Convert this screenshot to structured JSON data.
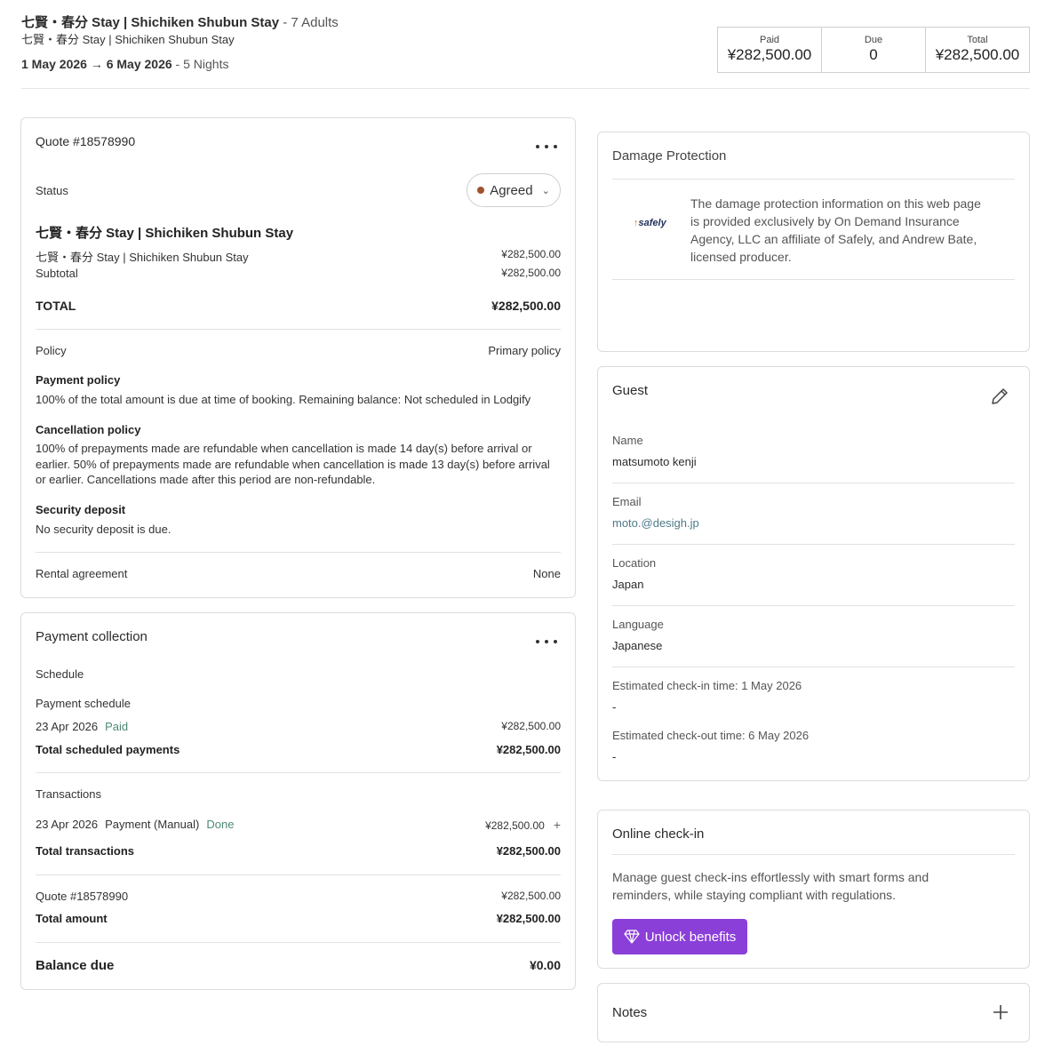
{
  "header": {
    "title_main": "七賢・春分",
    "title_main_suffix": " Stay | Shichiken Shubun Stay",
    "title_guests": " - 7 Adults",
    "subtitle": "七賢・春分 Stay | Shichiken Shubun Stay",
    "dates": "1 May 2026 → 6 May 2026",
    "nights": " - 5 Nights"
  },
  "totals": {
    "paid_label": "Paid",
    "paid_value": "¥282,500.00",
    "due_label": "Due",
    "due_value": "0",
    "total_label": "Total",
    "total_value": "¥282,500.00"
  },
  "quote": {
    "title": "Quote #18578990",
    "status_label": "Status",
    "status_value": "Agreed",
    "property_name": "七賢・春分 Stay | Shichiken Shubun Stay",
    "line_item": "七賢・春分 Stay | Shichiken Shubun Stay",
    "line_amount": "¥282,500.00",
    "subtotal_label": "Subtotal",
    "subtotal_value": "¥282,500.00",
    "total_label": "TOTAL",
    "total_value": "¥282,500.00",
    "policy_label": "Policy",
    "policy_value": "Primary policy",
    "payment_policy_title": "Payment policy",
    "payment_policy_text": "100% of the total amount is due at time of booking. Remaining balance: Not scheduled in Lodgify",
    "cancellation_title": "Cancellation policy",
    "cancellation_text": "100% of prepayments made are refundable when cancellation is made 14 day(s) before arrival or earlier. 50% of prepayments made are refundable when cancellation is made 13 day(s) before arrival or earlier. Cancellations made after this period are non-refundable.",
    "security_title": "Security deposit",
    "security_text": "No security deposit is due.",
    "rental_label": "Rental agreement",
    "rental_value": "None"
  },
  "payment": {
    "title": "Payment collection",
    "schedule_label": "Schedule",
    "payment_schedule_label": "Payment schedule",
    "sched_date": "23 Apr 2026",
    "sched_status": "Paid",
    "sched_amount": "¥282,500.00",
    "total_sched_label": "Total scheduled payments",
    "total_sched_value": "¥282,500.00",
    "transactions_label": "Transactions",
    "tx_date": "23 Apr 2026",
    "tx_type": "Payment (Manual)",
    "tx_status": "Done",
    "tx_amount": "¥282,500.00",
    "total_tx_label": "Total transactions",
    "total_tx_value": "¥282,500.00",
    "quote_ref": "Quote #18578990",
    "quote_ref_value": "¥282,500.00",
    "total_amount_label": "Total amount",
    "total_amount_value": "¥282,500.00",
    "balance_label": "Balance due",
    "balance_value": "¥0.00"
  },
  "damage": {
    "title": "Damage Protection",
    "logo_text": "safely",
    "text": "The damage protection information on this web page is provided exclusively by On Demand Insurance Agency, LLC an affiliate of Safely, and Andrew Bate, licensed producer."
  },
  "guest": {
    "title": "Guest",
    "name_label": "Name",
    "name_value": "matsumoto kenji",
    "email_label": "Email",
    "email_value": "moto.@desigh.jp",
    "location_label": "Location",
    "location_value": "Japan",
    "language_label": "Language",
    "language_value": "Japanese",
    "checkin_label": "Estimated check-in time: 1 May 2026",
    "checkin_value": "-",
    "checkout_label": "Estimated check-out time: 6 May 2026",
    "checkout_value": "-"
  },
  "online_checkin": {
    "title": "Online check-in",
    "text": "Manage guest check-ins effortlessly with smart forms and reminders, while staying compliant with regulations.",
    "button_label": "Unlock benefits"
  },
  "notes": {
    "title": "Notes"
  }
}
